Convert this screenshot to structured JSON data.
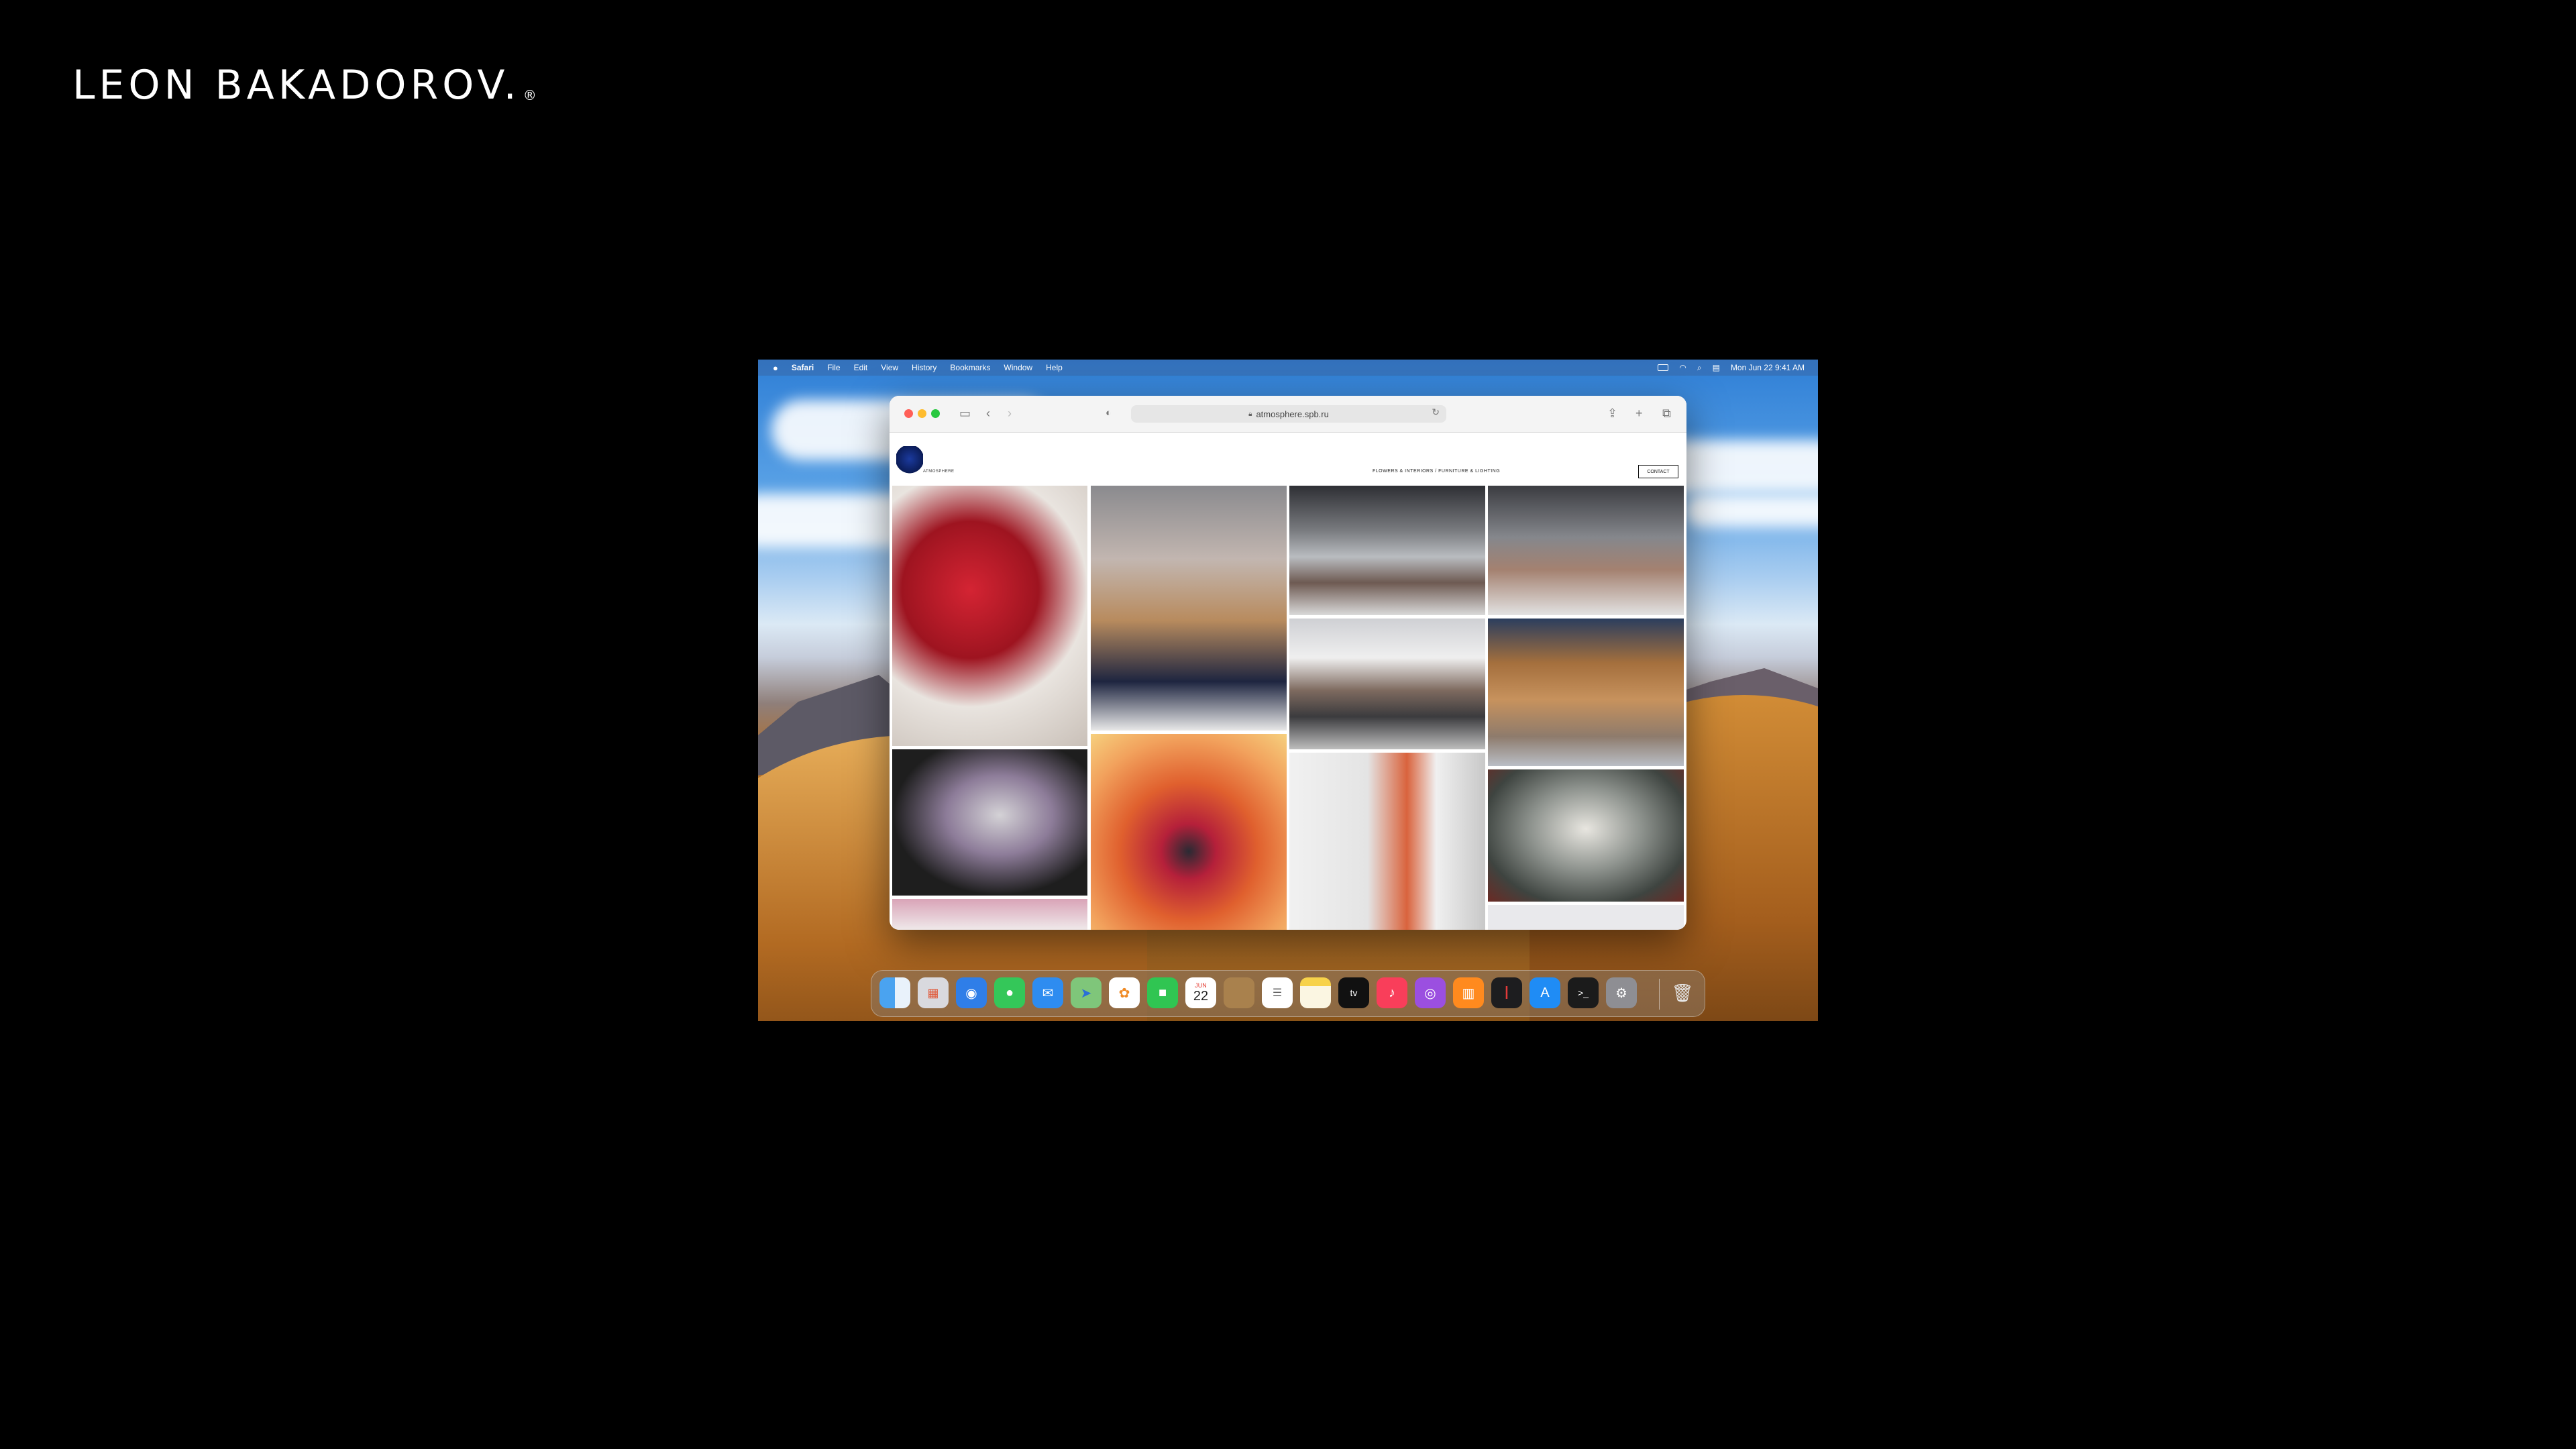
{
  "brand": {
    "name": "LEON BAKADOROV.",
    "reg": "®"
  },
  "menubar": {
    "items": [
      "Safari",
      "File",
      "Edit",
      "View",
      "History",
      "Bookmarks",
      "Window",
      "Help"
    ],
    "datetime": "Mon Jun 22  9:41 AM"
  },
  "browser": {
    "url": "atmosphere.spb.ru"
  },
  "site": {
    "logo_text": "ATMOSPHERE",
    "nav": "FLOWERS & INTERIORS / FURNITURE & LIGHTING",
    "contact": "CONTACT"
  },
  "dock": {
    "calendar_month": "JUN",
    "calendar_day": "22",
    "tv_label": "tv"
  },
  "colors": {
    "desktop_background": "#000000",
    "close": "#ff5f57",
    "minimize": "#febc2e",
    "zoom": "#28c840"
  }
}
